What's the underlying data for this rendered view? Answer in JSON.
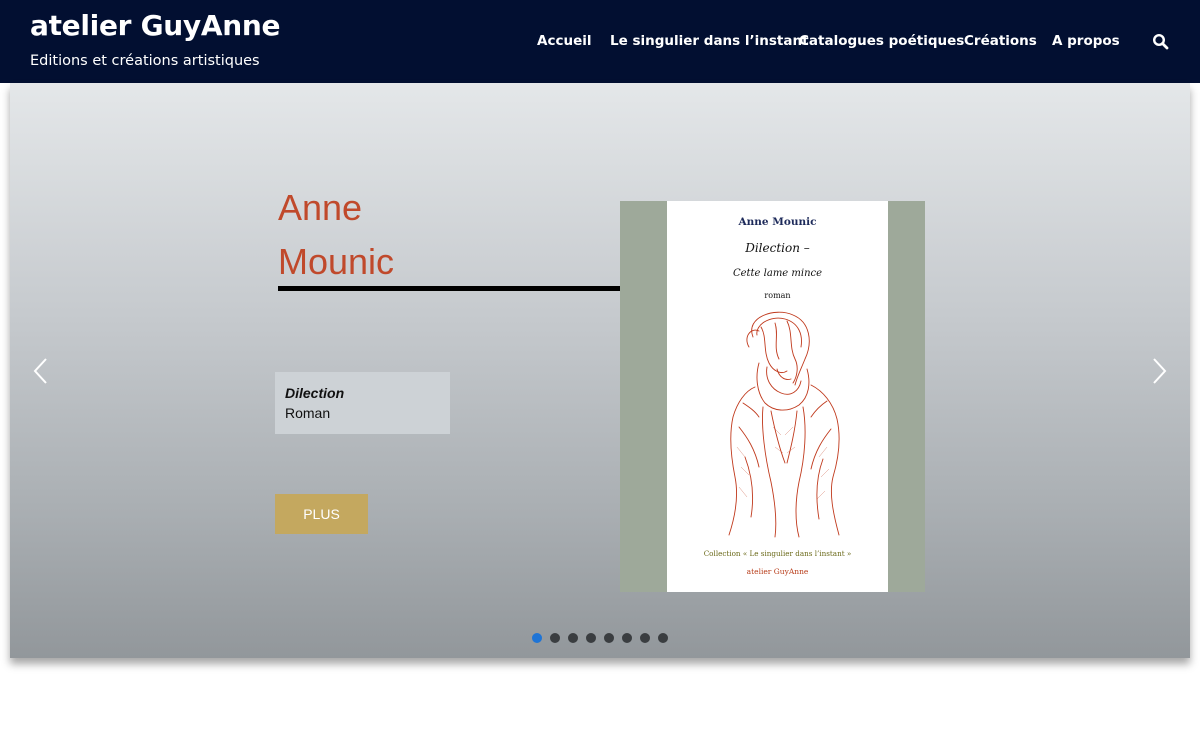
{
  "header": {
    "site_title": "atelier GuyAnne",
    "tagline": "Editions et créations artistiques",
    "background_color": "#020f31",
    "nav": [
      {
        "label": "Accueil"
      },
      {
        "label": "Le singulier dans l’instant"
      },
      {
        "label": "Catalogues poétiques"
      },
      {
        "label": "Créations"
      },
      {
        "label": "A propos"
      }
    ],
    "search_icon": "search-icon"
  },
  "slider": {
    "author_line1": "Anne",
    "author_line2": "Mounic",
    "author_color": "#c0492b",
    "book_title": "Dilection",
    "book_genre": "Roman",
    "button_label": "PLUS",
    "button_color": "#c4a85f",
    "cover": {
      "author": "Anne Mounic",
      "title": "Dilection –",
      "subtitle": "Cette lame mince",
      "genre": "roman",
      "collection": "Collection « Le singulier dans l’instant »",
      "publisher": "atelier GuyAnne"
    },
    "prev_icon": "chevron-left-icon",
    "next_icon": "chevron-right-icon",
    "slide_count": 8,
    "active_slide": 1,
    "active_dot_color": "#1e74d6"
  }
}
